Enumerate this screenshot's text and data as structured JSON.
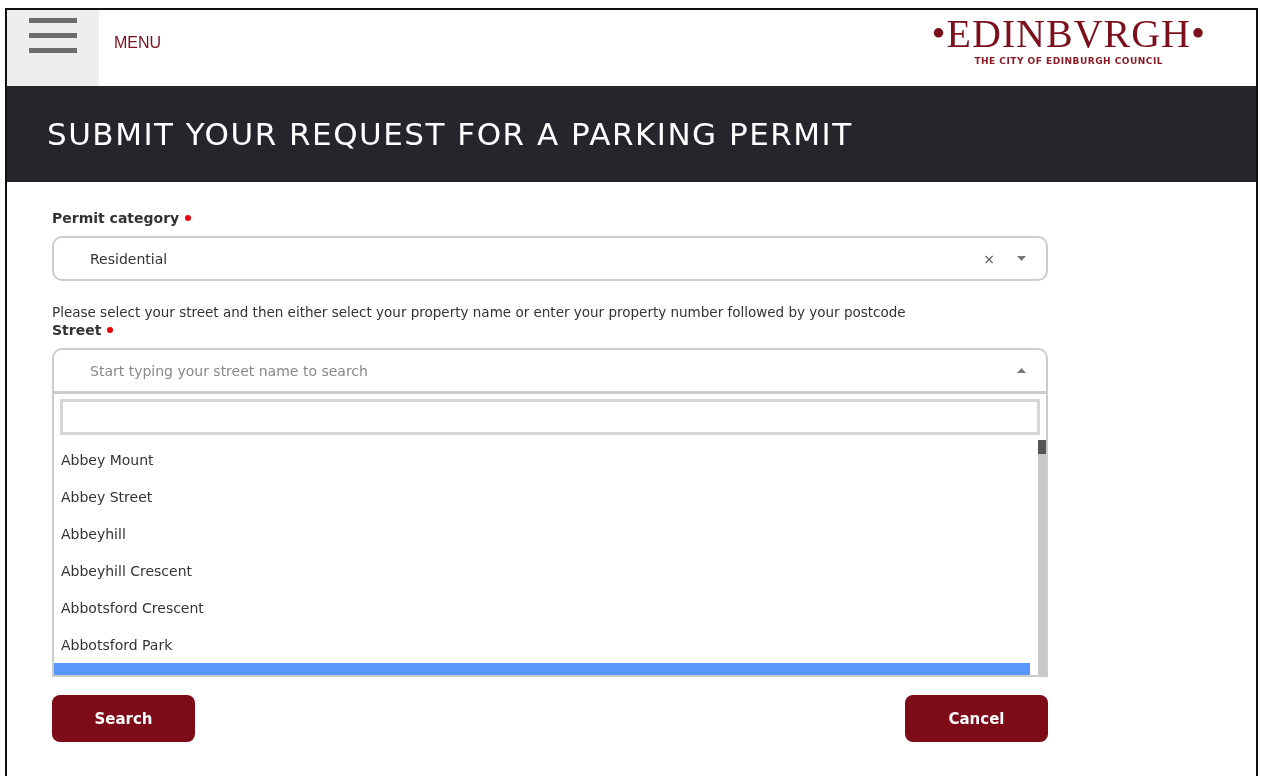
{
  "header": {
    "menu_label": "MENU",
    "logo": {
      "wordmark": "•EDINBVRGH•",
      "subtitle": "THE CITY OF EDINBURGH COUNCIL"
    }
  },
  "title": "SUBMIT YOUR REQUEST FOR A PARKING PERMIT",
  "form": {
    "permit_category": {
      "label": "Permit category",
      "required": true,
      "value": "Residential",
      "clear": "×"
    },
    "instructions": "Please select your street and then either select your property name or enter your property number followed by your postcode",
    "street": {
      "label": "Street",
      "required": true,
      "placeholder": "Start typing your street name to search",
      "expanded": true,
      "options": [
        {
          "label": "Abbey Mount",
          "selected": false
        },
        {
          "label": "Abbey Street",
          "selected": false
        },
        {
          "label": "Abbeyhill",
          "selected": false
        },
        {
          "label": "Abbeyhill Crescent",
          "selected": false
        },
        {
          "label": "Abbotsford Crescent",
          "selected": false
        },
        {
          "label": "Abbotsford Park",
          "selected": false
        }
      ]
    }
  },
  "buttons": [
    {
      "label": "Search"
    },
    {
      "label": "Cancel"
    }
  ]
}
